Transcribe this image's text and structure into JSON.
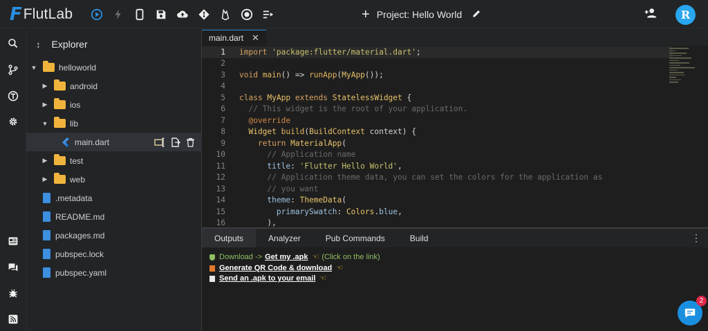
{
  "header": {
    "logo_text": "FlutLab",
    "project_title": "Project: Hello World",
    "avatar_initial": "R",
    "tools": [
      "run-icon",
      "hot-reload-icon",
      "device-icon",
      "save-icon",
      "cloud-upload-icon",
      "git-icon",
      "firebase-icon",
      "target-icon",
      "playlist-icon"
    ]
  },
  "activity": {
    "top": [
      "search-icon",
      "source-control-icon",
      "testing-icon",
      "settings-icon"
    ],
    "bottom": [
      "news-icon",
      "chat-bubbles-icon",
      "bug-icon",
      "rss-icon"
    ]
  },
  "explorer": {
    "title": "Explorer",
    "items": [
      {
        "label": "helloworld",
        "type": "folder",
        "depth": 0,
        "expanded": true
      },
      {
        "label": "android",
        "type": "folder",
        "depth": 1,
        "expanded": false
      },
      {
        "label": "ios",
        "type": "folder",
        "depth": 1,
        "expanded": false
      },
      {
        "label": "lib",
        "type": "folder",
        "depth": 1,
        "expanded": true
      },
      {
        "label": "main.dart",
        "type": "dart",
        "depth": 2,
        "selected": true
      },
      {
        "label": "test",
        "type": "folder",
        "depth": 1,
        "expanded": false
      },
      {
        "label": "web",
        "type": "folder",
        "depth": 1,
        "expanded": false
      },
      {
        "label": ".metadata",
        "type": "file",
        "depth": 1
      },
      {
        "label": "README.md",
        "type": "file",
        "depth": 1
      },
      {
        "label": "packages.md",
        "type": "file",
        "depth": 1
      },
      {
        "label": "pubspec.lock",
        "type": "file",
        "depth": 1
      },
      {
        "label": "pubspec.yaml",
        "type": "file",
        "depth": 1
      }
    ]
  },
  "editor": {
    "tab_label": "main.dart",
    "current_line": 1,
    "lines": [
      {
        "n": "1",
        "tokens": [
          [
            "kw",
            "import "
          ],
          [
            "str",
            "'package:flutter/material.dart'"
          ],
          [
            "def",
            ";"
          ]
        ]
      },
      {
        "n": "2",
        "tokens": []
      },
      {
        "n": "3",
        "tokens": [
          [
            "kw",
            "void "
          ],
          [
            "fn",
            "main"
          ],
          [
            "def",
            "() => "
          ],
          [
            "fn",
            "runApp"
          ],
          [
            "def",
            "("
          ],
          [
            "cls",
            "MyApp"
          ],
          [
            "def",
            "());"
          ]
        ]
      },
      {
        "n": "4",
        "tokens": []
      },
      {
        "n": "5",
        "tokens": [
          [
            "kw",
            "class "
          ],
          [
            "cls",
            "MyApp "
          ],
          [
            "kw",
            "extends "
          ],
          [
            "cls",
            "StatelessWidget"
          ],
          [
            "def",
            " {"
          ]
        ]
      },
      {
        "n": "6",
        "tokens": [
          [
            "cmt",
            "  // This widget is the root of your application."
          ]
        ]
      },
      {
        "n": "7",
        "tokens": [
          [
            "ann",
            "  @override"
          ]
        ]
      },
      {
        "n": "8",
        "tokens": [
          [
            "cls",
            "  Widget "
          ],
          [
            "fn",
            "build"
          ],
          [
            "def",
            "("
          ],
          [
            "cls",
            "BuildContext "
          ],
          [
            "def",
            "context) {"
          ]
        ]
      },
      {
        "n": "9",
        "tokens": [
          [
            "kw",
            "    return "
          ],
          [
            "cls",
            "MaterialApp"
          ],
          [
            "def",
            "("
          ]
        ]
      },
      {
        "n": "10",
        "tokens": [
          [
            "cmt",
            "      // Application name"
          ]
        ]
      },
      {
        "n": "11",
        "tokens": [
          [
            "prm",
            "      title"
          ],
          [
            "def",
            ": "
          ],
          [
            "str",
            "'Flutter Hello World'"
          ],
          [
            "def",
            ","
          ]
        ]
      },
      {
        "n": "12",
        "tokens": [
          [
            "cmt",
            "      // Application theme data, you can set the colors for the application as"
          ]
        ]
      },
      {
        "n": "13",
        "tokens": [
          [
            "cmt",
            "      // you want"
          ]
        ]
      },
      {
        "n": "14",
        "tokens": [
          [
            "prm",
            "      theme"
          ],
          [
            "def",
            ": "
          ],
          [
            "cls",
            "ThemeData"
          ],
          [
            "def",
            "("
          ]
        ]
      },
      {
        "n": "15",
        "tokens": [
          [
            "prm",
            "        primarySwatch"
          ],
          [
            "def",
            ": "
          ],
          [
            "cls",
            "Colors"
          ],
          [
            "def",
            "."
          ],
          [
            "prm",
            "blue"
          ],
          [
            "def",
            ","
          ]
        ]
      },
      {
        "n": "16",
        "tokens": [
          [
            "def",
            "      ),"
          ]
        ]
      }
    ]
  },
  "panel": {
    "tabs": [
      "Outputs",
      "Analyzer",
      "Pub Commands",
      "Build"
    ],
    "active_tab": 0,
    "output": {
      "download_prefix": "Download -> ",
      "download_link": "Get my .apk",
      "download_suffix": "(Click on the link)",
      "qr_link": "Generate QR Code & download",
      "email_link": "Send an .apk to your email"
    }
  },
  "chat": {
    "badge_count": "2"
  },
  "colors": {
    "accent": "#2a8fe0",
    "folder": "#f0b43c",
    "file": "#3d8fe0",
    "badge": "#e0294a"
  }
}
